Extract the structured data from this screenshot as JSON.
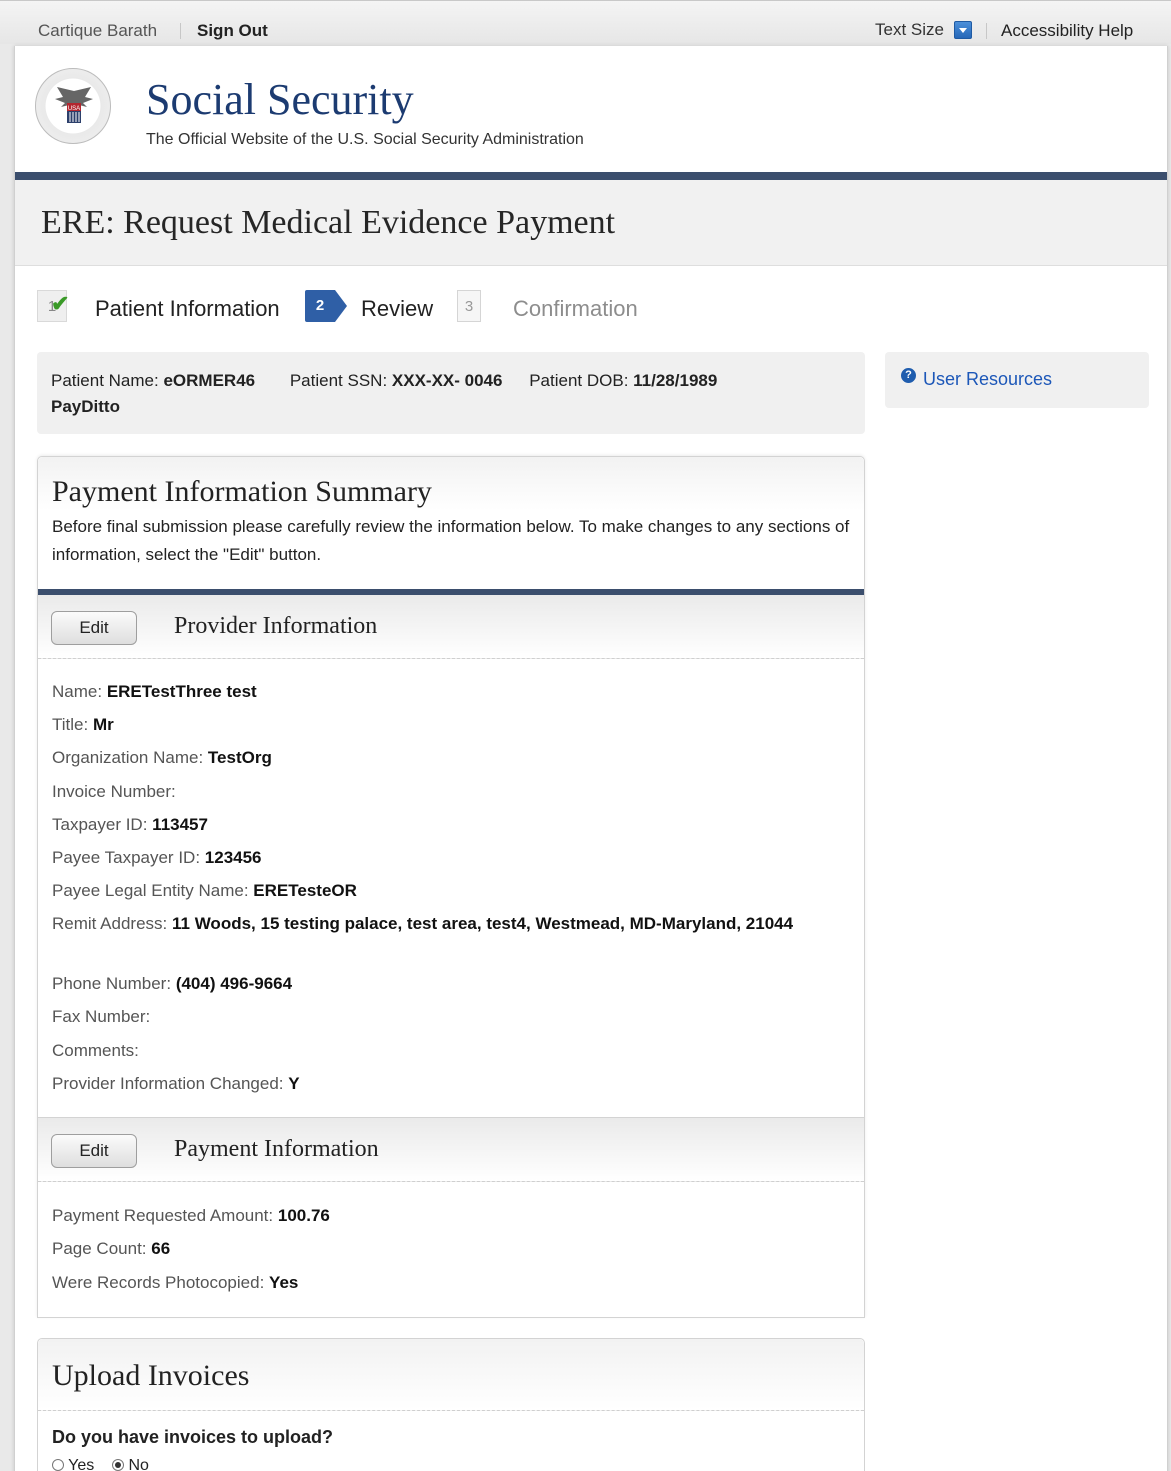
{
  "topbar": {
    "user_name": "Cartique Barath",
    "sign_out": "Sign Out",
    "text_size": "Text Size",
    "accessibility_help": "Accessibility Help"
  },
  "header": {
    "title": "Social Security",
    "subtitle": "The Official Website of the U.S. Social Security Administration",
    "seal_text": "SOCIAL SECURITY ADMINISTRATION USA"
  },
  "page": {
    "title": "ERE: Request Medical Evidence Payment"
  },
  "steps": [
    {
      "number": "1",
      "label": "Patient Information",
      "state": "complete"
    },
    {
      "number": "2",
      "label": "Review",
      "state": "current"
    },
    {
      "number": "3",
      "label": "Confirmation",
      "state": "upcoming"
    }
  ],
  "patient": {
    "name_label": "Patient Name:",
    "name_value": "eORMER46",
    "name_value_2": "PayDitto",
    "ssn_label": "Patient SSN:",
    "ssn_value": "XXX-XX- 0046",
    "dob_label": "Patient DOB:",
    "dob_value": "11/28/1989"
  },
  "resources": {
    "link": "User Resources"
  },
  "summary": {
    "title": "Payment Information Summary",
    "instructions": "Before final submission please carefully review the information below. To make changes to any sections of information, select the \"Edit\" button."
  },
  "provider": {
    "edit_label": "Edit",
    "title": "Provider Information",
    "fields": [
      {
        "label": "Name:",
        "value": "ERETestThree test"
      },
      {
        "label": "Title:",
        "value": "Mr"
      },
      {
        "label": "Organization Name:",
        "value": "TestOrg"
      },
      {
        "label": "Invoice Number:",
        "value": ""
      },
      {
        "label": "Taxpayer ID:",
        "value": "113457"
      },
      {
        "label": "Payee Taxpayer ID:",
        "value": "123456"
      },
      {
        "label": "Payee Legal Entity Name:",
        "value": "ERETesteOR"
      },
      {
        "label": "Remit Address:",
        "value": "11 Woods, 15 testing palace, test area, test4, Westmead, MD-Maryland, 21044"
      },
      {
        "label": "Phone Number:",
        "value": "(404) 496-9664"
      },
      {
        "label": "Fax Number:",
        "value": ""
      },
      {
        "label": "Comments:",
        "value": ""
      },
      {
        "label": "Provider Information Changed:",
        "value": "Y"
      }
    ]
  },
  "payment": {
    "edit_label": "Edit",
    "title": "Payment Information",
    "fields": [
      {
        "label": "Payment Requested Amount:",
        "value": "100.76"
      },
      {
        "label": "Page Count:",
        "value": "66"
      },
      {
        "label": "Were Records Photocopied:",
        "value": "Yes"
      }
    ]
  },
  "upload": {
    "title": "Upload Invoices",
    "question": "Do you have invoices to upload?",
    "option_yes": "Yes",
    "option_no": "No",
    "selected": "No"
  },
  "colors": {
    "brand_navy": "#1c3b71",
    "rule": "#3b4e6d",
    "link": "#1c57b8",
    "step_active": "#2f5fa6",
    "check_green": "#3a9a28"
  }
}
